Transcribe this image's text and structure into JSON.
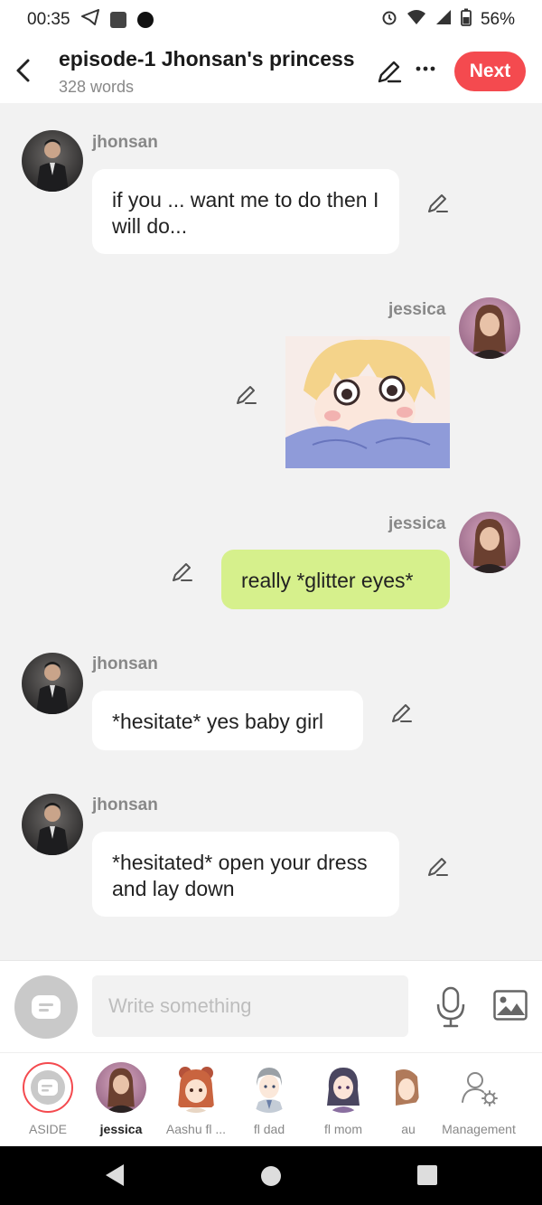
{
  "status": {
    "time": "00:35",
    "battery": "56%"
  },
  "header": {
    "title": "episode-1 Jhonsan's princess",
    "word_count": "328 words",
    "next_label": "Next"
  },
  "messages": [
    {
      "sender": "jhonsan",
      "text": "if you ... want me to do then I will do..."
    },
    {
      "sender": "jessica"
    },
    {
      "sender": "jessica",
      "text": "really *glitter eyes*"
    },
    {
      "sender": "jhonsan",
      "text": "*hesitate* yes baby girl"
    },
    {
      "sender": "jhonsan",
      "text": "*hesitated* open your dress and lay down"
    }
  ],
  "composer": {
    "placeholder": "Write something"
  },
  "characters": [
    {
      "label": "ASIDE"
    },
    {
      "label": "jessica"
    },
    {
      "label": "Aashu fl ..."
    },
    {
      "label": "fl dad"
    },
    {
      "label": "fl mom"
    },
    {
      "label": "au"
    },
    {
      "label": "Management"
    }
  ],
  "colors": {
    "accent": "#f44a4f",
    "own_bubble": "#d6f08c",
    "background": "#f2f2f2"
  }
}
